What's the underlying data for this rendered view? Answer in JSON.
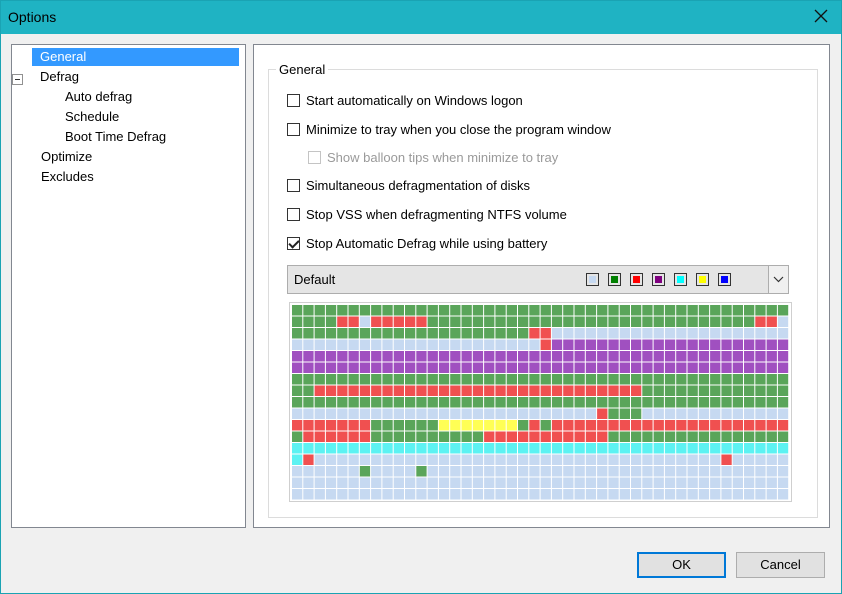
{
  "window": {
    "title": "Options"
  },
  "tree": {
    "items": [
      {
        "label": "General",
        "selected": true
      },
      {
        "label": "Defrag",
        "expanded": true
      },
      {
        "label": "Auto defrag"
      },
      {
        "label": "Schedule"
      },
      {
        "label": "Boot Time Defrag"
      },
      {
        "label": "Optimize"
      },
      {
        "label": "Excludes"
      }
    ]
  },
  "general": {
    "title": "General",
    "options": [
      {
        "label": "Start automatically on Windows logon",
        "checked": false,
        "enabled": true
      },
      {
        "label": "Minimize to tray when you close the program window",
        "checked": false,
        "enabled": true
      },
      {
        "label": "Show balloon tips when minimize to tray",
        "checked": false,
        "enabled": false
      },
      {
        "label": "Simultaneous defragmentation of disks",
        "checked": false,
        "enabled": true
      },
      {
        "label": "Stop VSS when defragmenting NTFS volume",
        "checked": false,
        "enabled": true
      },
      {
        "label": "Stop Automatic Defrag while using battery",
        "checked": true,
        "enabled": true
      }
    ],
    "scheme": {
      "selected": "Default",
      "colors": [
        "#c6d9f1",
        "#008000",
        "#ff0000",
        "#800080",
        "#00ffff",
        "#ffff00",
        "#0000ff"
      ]
    }
  },
  "cluster_map": {
    "palette": {
      "g": "#5aa55a",
      "r": "#f05050",
      "p": "#a050c0",
      "c": "#5cf2f2",
      "y": "#ffff55",
      "b": "#c6d9f1",
      "w": "#ffffff"
    },
    "rows": [
      "gggggggggggggggggggggggggggggggggggggggggggg",
      "ggggrrbrrrrrgggggggggggggggggggggggggggggrrb",
      "gggggggggggggggggggggrrbbbbbbbbbbbbbbbbbbbbb",
      "bbbbbbbbbbbbbbbbbbbbbbrppppppppppppppppppppp",
      "pppppppppppppppppppppppppppppppppppppppppppp",
      "pppppppppppppppppppppppppppppppppppppppppppp",
      "ggggggggggggggggggggggggggggggggggggggggggggg",
      "ggrrrrrrrrrrrrrrrrrrrrrrrrrrrrrgggggggggggggg",
      "gggggggggggggggggggggggggggggggggggggggggggg",
      "bbbbbbbbbbbbbbbbbbbbbbbbbbbrgggbbbbbbbbbbbbb",
      "rrrrrrrggggggyyyyyyygrgrrrrrrrrrrrrrrrrrrrrr",
      "grrrrrrggggggggggrrrrrrrrrrrgggggggggggggggg",
      "ccccccccccccccccccccccccccccccccccccccccccccc",
      "crbbbbbbbbbbbbbbbbbbbbbbbbbbbbbbbbbbbbrbbbbbb",
      "bbbbbbgbbbbgbbbbbbbbbbbbbbbbbbbbbbbbbbbbbbbb",
      "bbbbbbbbbbbbbbbbbbbbbbbbbbbbbbbbbbbbbbbbbbbb",
      "bbbbbbbbbbbbbbbbbbbbbbbbbbbbbbbbbbbbbbbbbbbb"
    ]
  },
  "buttons": {
    "ok": "OK",
    "cancel": "Cancel"
  }
}
